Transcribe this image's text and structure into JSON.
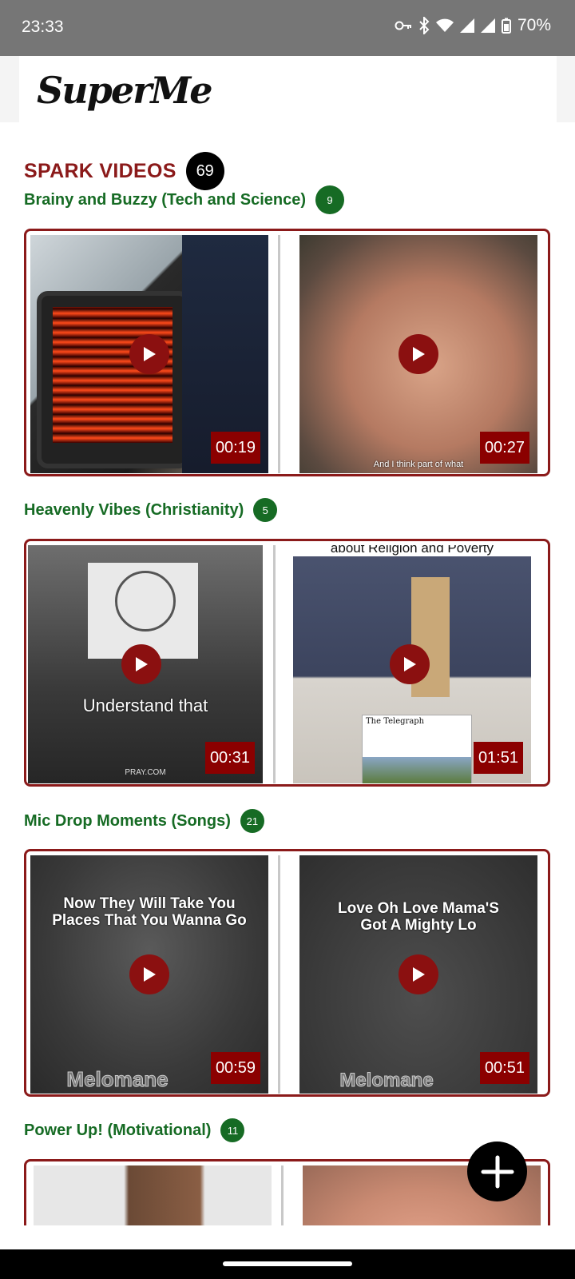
{
  "status_bar": {
    "time": "23:33",
    "battery": "70%"
  },
  "app": {
    "logo_text": "SuperMe"
  },
  "section": {
    "title": "SPARK VIDEOS",
    "count": "69"
  },
  "categories": [
    {
      "title": "Brainy and Buzzy (Tech and Science)",
      "count": "9",
      "videos": [
        {
          "duration": "00:19",
          "caption": ""
        },
        {
          "duration": "00:27",
          "caption": "And I think part of what"
        }
      ]
    },
    {
      "title": "Heavenly Vibes (Christianity)",
      "count": "5",
      "videos": [
        {
          "duration": "00:31",
          "caption": "Understand that",
          "watermark": "PRAY.COM"
        },
        {
          "duration": "01:51",
          "caption": "about Religion and Poverty",
          "newspaper": "The Telegraph"
        }
      ]
    },
    {
      "title": "Mic Drop Moments (Songs)",
      "count": "21",
      "videos": [
        {
          "duration": "00:59",
          "caption": "Now They Will Take You Places That You Wanna Go",
          "watermark": "Melomane"
        },
        {
          "duration": "00:51",
          "caption": "Love Oh Love Mama'S Got A Mighty Lo",
          "watermark": "Melomane"
        }
      ]
    },
    {
      "title": "Power Up! (Motivational)",
      "count": "11",
      "videos": [
        {
          "duration": "",
          "caption": ""
        },
        {
          "duration": "",
          "caption": ""
        }
      ]
    }
  ],
  "colors": {
    "accent_red": "#8b1a1a",
    "category_green": "#166b24"
  },
  "icons": {
    "play": "play-icon",
    "fab": "plus-icon"
  }
}
